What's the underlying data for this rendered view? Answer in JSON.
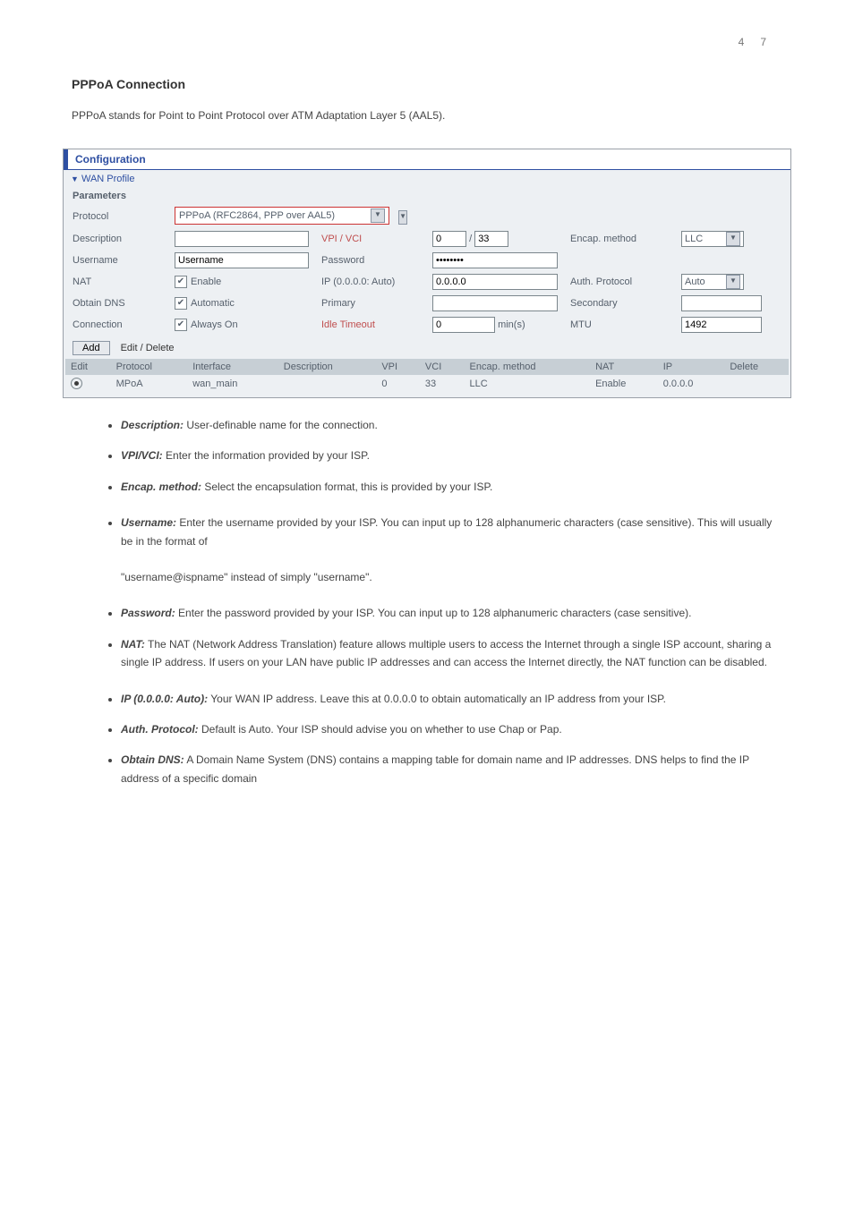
{
  "page_number": "47",
  "heading": "PPPoA Connection",
  "intro_line": "PPPoA stands for Point to Point Protocol over ATM Adaptation Layer 5 (AAL5).",
  "panel": {
    "title": "Configuration",
    "section": "WAN Profile",
    "params_label": "Parameters",
    "rows": {
      "protocol_label": "Protocol",
      "protocol_value": "PPPoA (RFC2864, PPP over AAL5)",
      "desc_label": "Description",
      "desc_value": "",
      "vpi_vci_label": "VPI / VCI",
      "vpi_value": "0",
      "vci_value": "33",
      "encap_label": "Encap. method",
      "encap_value": "LLC",
      "user_label": "Username",
      "user_value": "Username",
      "pass_label": "Password",
      "pass_value": "••••••••",
      "nat_label": "NAT",
      "nat_chk": "Enable",
      "ip_label": "IP (0.0.0.0: Auto)",
      "ip_value": "0.0.0.0",
      "auth_label": "Auth. Protocol",
      "auth_value": "Auto",
      "dns_label": "Obtain DNS",
      "dns_chk": "Automatic",
      "primary_label": "Primary",
      "secondary_label": "Secondary",
      "conn_label": "Connection",
      "conn_chk": "Always On",
      "idle_label": "Idle Timeout",
      "idle_value": "0",
      "idle_unit": "min(s)",
      "mtu_label": "MTU",
      "mtu_value": "1492"
    },
    "addbar": {
      "add": "Add",
      "edit_delete": "Edit / Delete"
    },
    "table": {
      "headers": [
        "Edit",
        "Protocol",
        "Interface",
        "Description",
        "VPI",
        "VCI",
        "Encap. method",
        "NAT",
        "IP",
        "Delete"
      ],
      "row": {
        "protocol": "MPoA",
        "interface": "wan_main",
        "description": "",
        "vpi": "0",
        "vci": "33",
        "encap": "LLC",
        "nat": "Enable",
        "ip": "0.0.0.0",
        "delete": ""
      }
    }
  },
  "list": [
    {
      "lead": "Description:",
      "text": " User-definable name for the connection."
    },
    {
      "lead": "VPI/VCI:",
      "text": " Enter the information provided by your ISP."
    },
    {
      "lead": "Encap. method:",
      "text": " Select the encapsulation format, this is provided by your ISP."
    },
    {
      "lead": "Username:",
      "text": " Enter the username provided by your ISP. You can input up to 128 alphanumeric characters (case sensitive). This will usually be in the format of",
      "cont": "\"username@ispname\" instead of simply \"username\"."
    },
    {
      "lead": "Password:",
      "text": " Enter the password provided by your ISP. You can input up to 128 alphanumeric characters (case sensitive)."
    },
    {
      "lead": "NAT:",
      "text": " The NAT (Network Address Translation) feature allows multiple users to access the Internet through a single ISP account, sharing a single IP address. If users on your LAN have public IP addresses and can access the Internet directly, the NAT function can be disabled."
    },
    {
      "lead": "IP (0.0.0.0: Auto):",
      "text": " Your WAN IP address. Leave this at 0.0.0.0 to obtain automatically an IP address from your ISP."
    },
    {
      "lead": "Auth. Protocol:",
      "text": " Default is Auto. Your ISP should advise you on whether to use Chap or Pap."
    },
    {
      "lead": "Obtain DNS:",
      "text": " A Domain Name System (DNS) contains a mapping table for domain name and IP addresses. DNS helps to find the IP address of a specific domain"
    }
  ]
}
